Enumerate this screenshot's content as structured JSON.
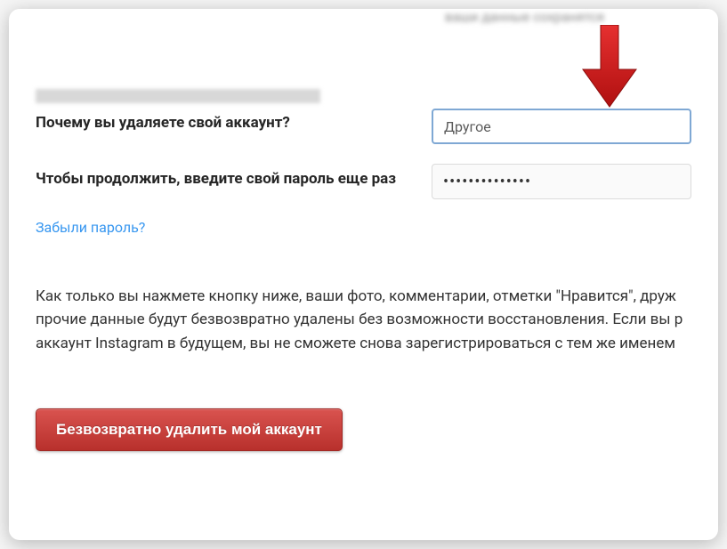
{
  "form": {
    "reason_label": "Почему вы удаляете свой аккаунт?",
    "reason_value": "Другое",
    "password_label": "Чтобы продолжить, введите свой пароль еще раз",
    "password_value": "••••••••••••••",
    "forgot_password": "Забыли пароль?"
  },
  "warning": "Как только вы нажмете кнопку ниже, ваши фото, комментарии, отметки \"Нравится\", друж прочие данные будут безвозвратно удалены без возможности восстановления. Если вы р аккаунт Instagram в будущем, вы не сможете снова зарегистрироваться с тем же именем",
  "button": {
    "delete": "Безвозвратно удалить мой аккаунт"
  }
}
